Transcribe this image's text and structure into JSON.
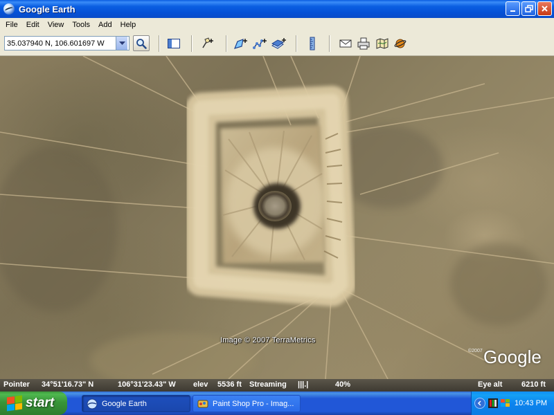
{
  "window": {
    "title": "Google Earth",
    "buttons": {
      "minimize": "_",
      "maximize": "❐",
      "close": "✕"
    }
  },
  "menu": [
    "File",
    "Edit",
    "View",
    "Tools",
    "Add",
    "Help"
  ],
  "toolbar": {
    "search_value": "35.037940 N, 106.601697 W",
    "buttons": [
      "sidebar-toggle",
      "placemark-add",
      "polygon-add",
      "path-add",
      "overlay-add",
      "ruler",
      "email",
      "print",
      "show-in-maps",
      "sky-toggle"
    ]
  },
  "map": {
    "attribution": "Image © 2007 TerraMetrics",
    "logo": "Google",
    "logo_small": "©2007"
  },
  "status": {
    "pointer_label": "Pointer",
    "lat": "34°51'16.73\" N",
    "lon": "106°31'23.43\" W",
    "elev_label": "elev",
    "elev_value": "5536 ft",
    "streaming_label": "Streaming",
    "streaming_bar": "|||.|",
    "streaming_percent": "40%",
    "eye_alt_label": "Eye alt",
    "eye_alt_value": "6210 ft"
  },
  "taskbar": {
    "start_label": "start",
    "tasks": [
      {
        "label": "Google Earth",
        "active": true
      },
      {
        "label": "Paint Shop Pro - Imag...",
        "active": false
      }
    ],
    "clock": "10:43 PM"
  },
  "colors": {
    "titlebar_blue": "#0551d6",
    "start_green": "#389538",
    "terrain": "#8a7d5e"
  }
}
